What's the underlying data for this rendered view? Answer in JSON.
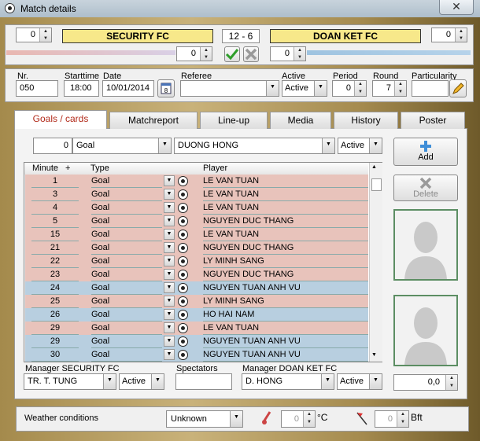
{
  "window": {
    "title": "Match details"
  },
  "match": {
    "home_team": "SECURITY FC",
    "away_team": "DOAN KET FC",
    "score": "12 - 6",
    "home_left_value": "0",
    "away_right_value": "0",
    "home_sub_value": "0",
    "away_sub_value": "0"
  },
  "fields": {
    "nr_label": "Nr.",
    "nr_value": "050",
    "starttime_label": "Starttime",
    "starttime_value": "18:00",
    "date_label": "Date",
    "date_value": "10/01/2014",
    "referee_label": "Referee",
    "referee_value": "",
    "active_label": "Active",
    "active_value": "Active",
    "period_label": "Period",
    "period_value": "0",
    "round_label": "Round",
    "round_value": "7",
    "particularity_label": "Particularity",
    "particularity_value": ""
  },
  "tabs": [
    "Goals / cards",
    "Matchreport",
    "Line-up",
    "Media",
    "History",
    "Poster"
  ],
  "goal_filter": {
    "minute": "0",
    "type": "Goal",
    "player": "DUONG HONG",
    "status": "Active"
  },
  "grid": {
    "headers": {
      "minute": "Minute",
      "plus": "+",
      "type": "Type",
      "player": "Player"
    },
    "rows": [
      {
        "minute": "1",
        "type": "Goal",
        "player": "LE VAN TUAN",
        "team": "home"
      },
      {
        "minute": "3",
        "type": "Goal",
        "player": "LE VAN TUAN",
        "team": "home"
      },
      {
        "minute": "4",
        "type": "Goal",
        "player": "LE VAN TUAN",
        "team": "home"
      },
      {
        "minute": "5",
        "type": "Goal",
        "player": "NGUYEN DUC THANG",
        "team": "home"
      },
      {
        "minute": "15",
        "type": "Goal",
        "player": "LE VAN TUAN",
        "team": "home"
      },
      {
        "minute": "21",
        "type": "Goal",
        "player": "NGUYEN DUC THANG",
        "team": "home"
      },
      {
        "minute": "22",
        "type": "Goal",
        "player": "LY MINH SANG",
        "team": "home"
      },
      {
        "minute": "23",
        "type": "Goal",
        "player": "NGUYEN DUC THANG",
        "team": "home"
      },
      {
        "minute": "24",
        "type": "Goal",
        "player": "NGUYEN TUAN ANH VU",
        "team": "away"
      },
      {
        "minute": "25",
        "type": "Goal",
        "player": "LY MINH SANG",
        "team": "home"
      },
      {
        "minute": "26",
        "type": "Goal",
        "player": "HO HAI NAM",
        "team": "away"
      },
      {
        "minute": "29",
        "type": "Goal",
        "player": "LE VAN TUAN",
        "team": "home"
      },
      {
        "minute": "29",
        "type": "Goal",
        "player": "NGUYEN TUAN ANH VU",
        "team": "away"
      },
      {
        "minute": "30",
        "type": "Goal",
        "player": "NGUYEN TUAN ANH VU",
        "team": "away"
      }
    ]
  },
  "buttons": {
    "add": "Add",
    "delete": "Delete"
  },
  "bottom": {
    "manager_home_label": "Manager SECURITY FC",
    "manager_home_value": "TR. T. TUNG",
    "manager_home_status": "Active",
    "spectators_label": "Spectators",
    "spectators_value": "",
    "manager_away_label": "Manager DOAN KET FC",
    "manager_away_value": "D. HONG",
    "manager_away_status": "Active",
    "rating_value": "0,0"
  },
  "weather": {
    "label": "Weather conditions",
    "condition": "Unknown",
    "temp_value": "0",
    "temp_unit": "°C",
    "wind_value": "0",
    "wind_unit": "Bft"
  },
  "colors": {
    "home_row": "#e8c3bb",
    "away_row": "#b8cfe0",
    "team_bar": "#f7e88a",
    "tab_active_text": "#b22b1b"
  }
}
